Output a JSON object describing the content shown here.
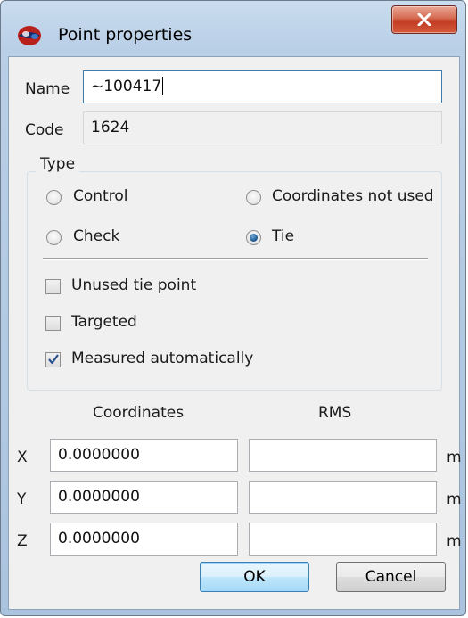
{
  "window": {
    "title": "Point properties"
  },
  "fields": {
    "name_label": "Name",
    "name_value": "~100417",
    "code_label": "Code",
    "code_value": "1624"
  },
  "type_group": {
    "title": "Type",
    "radios": [
      {
        "label": "Control",
        "checked": false
      },
      {
        "label": "Coordinates not used",
        "checked": false
      },
      {
        "label": "Check",
        "checked": false
      },
      {
        "label": "Tie",
        "checked": true
      }
    ],
    "checkboxes": [
      {
        "label": "Unused tie point",
        "checked": false
      },
      {
        "label": "Targeted",
        "checked": false
      },
      {
        "label": "Measured automatically",
        "checked": true
      }
    ]
  },
  "coords": {
    "coordinates_header": "Coordinates",
    "rms_header": "RMS",
    "rows": [
      {
        "axis": "X",
        "value": "0.0000000",
        "rms": "",
        "unit": "m"
      },
      {
        "axis": "Y",
        "value": "0.0000000",
        "rms": "",
        "unit": "m"
      },
      {
        "axis": "Z",
        "value": "0.0000000",
        "rms": "",
        "unit": "m"
      }
    ]
  },
  "buttons": {
    "ok": "OK",
    "cancel": "Cancel"
  }
}
